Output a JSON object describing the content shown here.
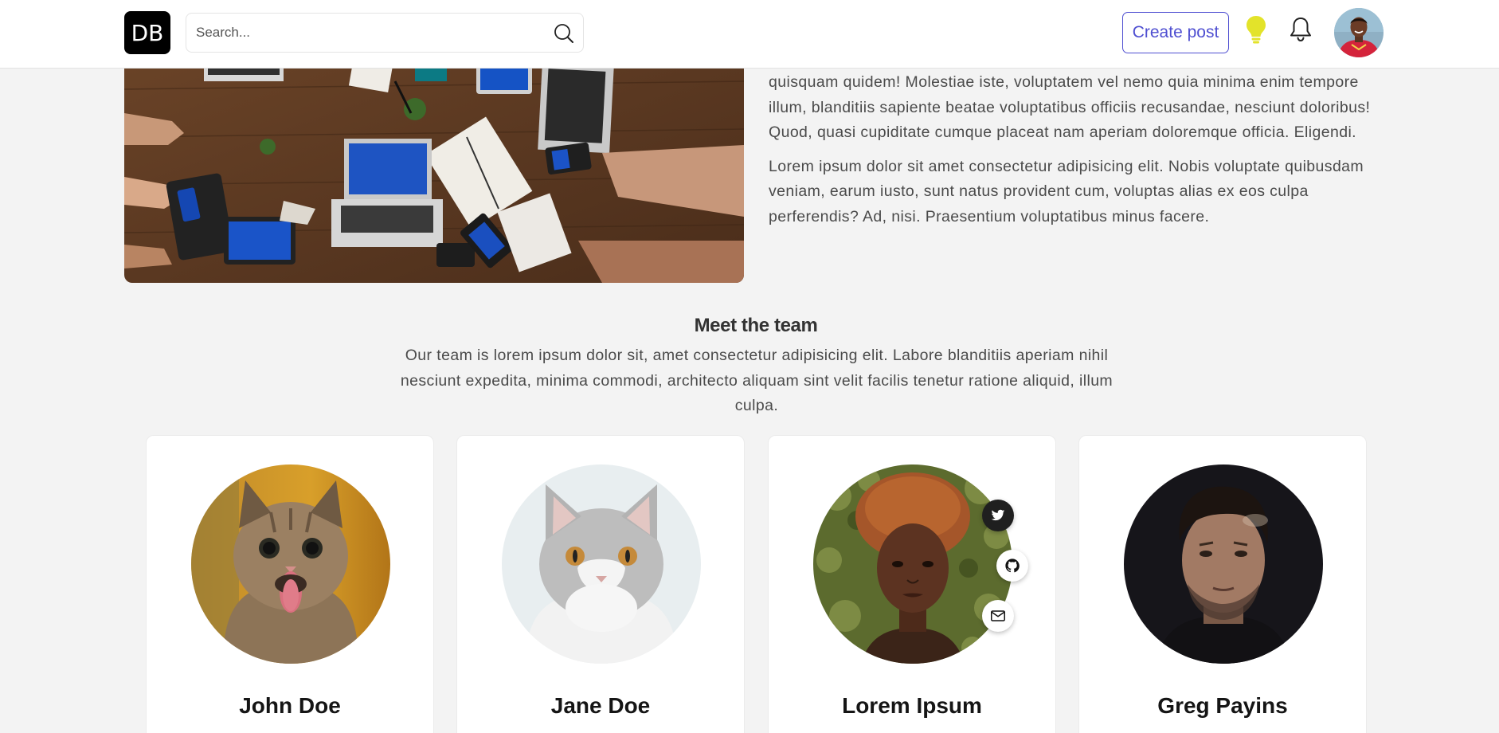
{
  "header": {
    "logo_text": "DB",
    "search_placeholder": "Search...",
    "create_post_label": "Create post",
    "icons": [
      "search-icon",
      "lightbulb-icon",
      "bell-icon"
    ],
    "accent_color": "#4f4fd1"
  },
  "intro": {
    "paragraphs": [
      "quisquam quidem! Molestiae iste, voluptatem vel nemo quia minima enim tempore illum, blanditiis sapiente beatae voluptatibus officiis recusandae, nesciunt doloribus! Quod, quasi cupiditate cumque placeat nam aperiam doloremque officia. Eligendi.",
      "Lorem ipsum dolor sit amet consectetur adipisicing elit. Nobis voluptate quibusdam veniam, earum iusto, sunt natus provident cum, voluptas alias ex eos culpa perferendis? Ad, nisi. Praesentium voluptatibus minus facere."
    ]
  },
  "team": {
    "title": "Meet the team",
    "description": "Our team is lorem ipsum dolor sit, amet consectetur adipisicing elit. Labore blanditiis aperiam nihil nesciunt expedita, minima commodi, architecto aliquam sint velit facilis tenetur ratione aliquid, illum culpa.",
    "members": [
      {
        "name": "John Doe"
      },
      {
        "name": "Jane Doe"
      },
      {
        "name": "Lorem Ipsum",
        "social_icons": [
          "twitter-icon",
          "github-icon",
          "mail-icon"
        ]
      },
      {
        "name": "Greg Payins"
      }
    ]
  }
}
